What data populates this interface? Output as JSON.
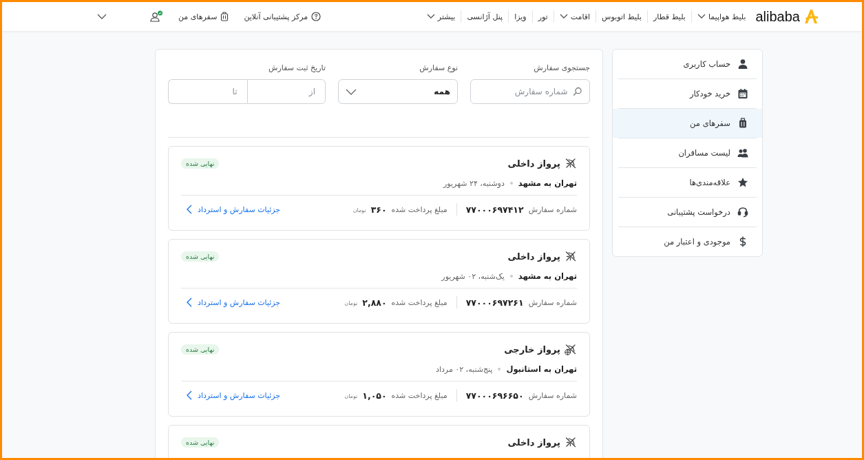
{
  "header": {
    "logo": "alibaba",
    "nav": [
      {
        "label": "بلیط هواپیما",
        "dropdown": true
      },
      {
        "label": "بلیط قطار",
        "dropdown": false
      },
      {
        "label": "بلیط اتوبوس",
        "dropdown": false
      },
      {
        "label": "اقامت",
        "dropdown": true
      },
      {
        "label": "تور",
        "dropdown": false
      },
      {
        "label": "ویزا",
        "dropdown": false
      },
      {
        "label": "پنل آژانسی",
        "dropdown": false
      },
      {
        "label": "بیشتر",
        "dropdown": true
      }
    ],
    "support": "مرکز پشتیبانی آنلاین",
    "my_trips": "سفرهای من",
    "user_verified": true
  },
  "sidebar": {
    "items": [
      {
        "label": "حساب کاربری",
        "kind": "person",
        "selected": false
      },
      {
        "label": "خرید خودکار",
        "kind": "calendar",
        "selected": false
      },
      {
        "label": "سفرهای من",
        "kind": "suitcase",
        "selected": true
      },
      {
        "label": "لیست مسافران",
        "kind": "people",
        "selected": false
      },
      {
        "label": "علاقه‌مندی‌ها",
        "kind": "star",
        "selected": false
      },
      {
        "label": "درخواست پشتیبانی",
        "kind": "headset",
        "selected": false
      },
      {
        "label": "موجودی و اعتبار من",
        "kind": "dollar",
        "selected": false
      }
    ]
  },
  "filters": {
    "search": {
      "label": "جستجوی سفارش",
      "placeholder": "شماره سفارش"
    },
    "type": {
      "label": "نوع سفارش",
      "value": "همه"
    },
    "date": {
      "label": "تاریخ ثبت سفارش",
      "from_placeholder": "از",
      "to_placeholder": "تا"
    }
  },
  "orders": [
    {
      "kind": "domestic",
      "title": "پرواز داخلی",
      "status": "نهایی شده",
      "route": "تهران به مشهد",
      "date": "دوشنبه، ۲۴ شهریور",
      "order_label": "شماره سفارش",
      "order_number": "۷۷۰۰۰۶۹۷۴۱۲",
      "paid_label": "مبلغ پرداخت شده",
      "amount": "۳۶۰",
      "currency": "تومان",
      "details_link": "جزئیات سفارش و استرداد"
    },
    {
      "kind": "domestic",
      "title": "پرواز داخلی",
      "status": "نهایی شده",
      "route": "تهران به مشهد",
      "date": "یک‌شنبه، ۰۲ شهریور",
      "order_label": "شماره سفارش",
      "order_number": "۷۷۰۰۰۶۹۷۲۶۱",
      "paid_label": "مبلغ پرداخت شده",
      "amount": "۲,۸۸۰",
      "currency": "تومان",
      "details_link": "جزئیات سفارش و استرداد"
    },
    {
      "kind": "international",
      "title": "پرواز خارجی",
      "status": "نهایی شده",
      "route": "تهران به استانبول",
      "date": "پنج‌شنبه، ۰۲ مرداد",
      "order_label": "شماره سفارش",
      "order_number": "۷۷۰۰۰۶۹۶۶۵۰",
      "paid_label": "مبلغ پرداخت شده",
      "amount": "۱,۰۵۰",
      "currency": "تومان",
      "details_link": "جزئیات سفارش و استرداد"
    },
    {
      "kind": "domestic",
      "title": "پرواز داخلی",
      "status": "نهایی شده"
    }
  ]
}
